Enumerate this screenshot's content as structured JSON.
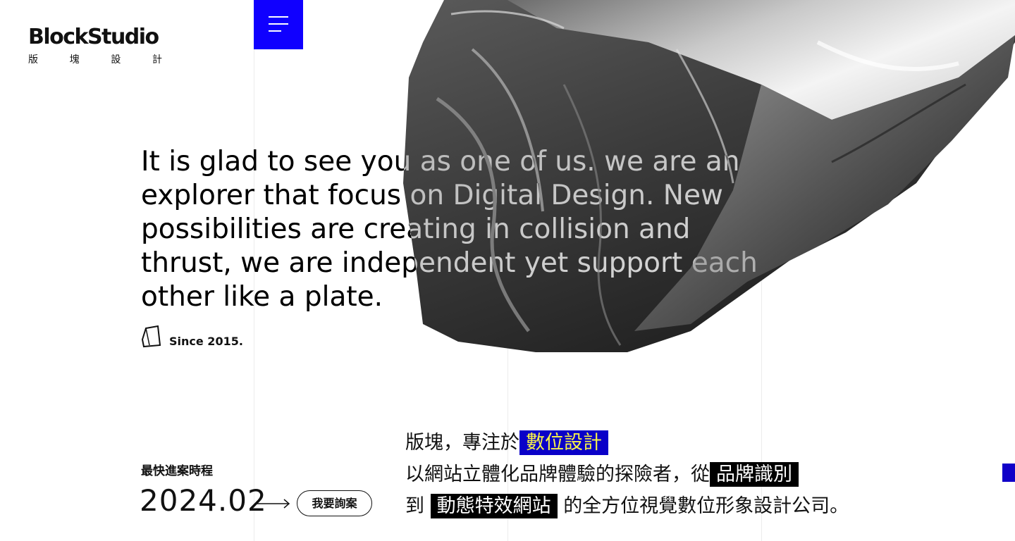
{
  "logo": {
    "name": "BlockStudio",
    "chars": [
      "版",
      "塊",
      "設",
      "計"
    ]
  },
  "menu": {
    "icon": "hamburger-menu-icon"
  },
  "hero": {
    "intro_lines": [
      "It is glad to see you as one of us. we are an",
      "explorer that focus on Digital Design. New",
      "possibilities are creating in collision and",
      "thrust, we are independent yet support each",
      "other like a plate."
    ],
    "since": "Since 2015.",
    "since_icon": "block-outline-icon"
  },
  "schedule": {
    "label": "最快進案時程",
    "date": "2024.02",
    "arrow_icon": "arrow-right-icon",
    "button": "我要詢案"
  },
  "tagline": {
    "line1_pre": "版塊，專注於",
    "line1_hl": "數位設計",
    "line2_pre": "以網站立體化品牌體驗的探險者，從",
    "line2_hl": "品牌識別",
    "line3_pre": "到",
    "line3_hl": "動態特效網站",
    "line3_post": "的全方位視覺數位形象設計公司。"
  },
  "colors": {
    "accent": "#1000ff",
    "highlight_blue": "#0a00c8",
    "highlight_text": "#f7f34a",
    "highlight_black": "#000000"
  }
}
